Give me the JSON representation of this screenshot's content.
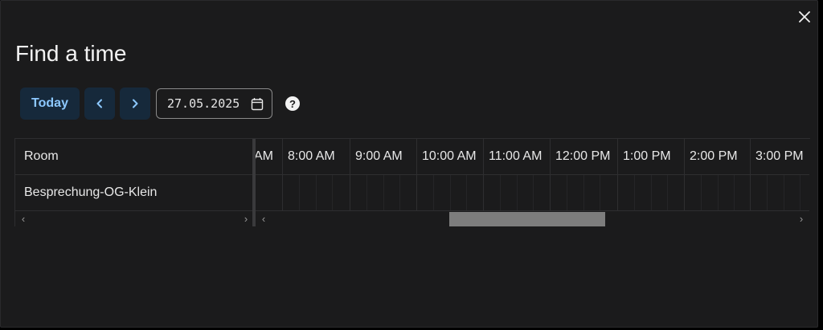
{
  "dialog": {
    "title": "Find a time",
    "close_icon": "close-icon"
  },
  "toolbar": {
    "today_label": "Today",
    "prev_icon": "chevron-left-icon",
    "next_icon": "chevron-right-icon",
    "date_value": "27.05.2025",
    "calendar_icon": "calendar-icon",
    "help_icon": "help-icon",
    "help_glyph": "?"
  },
  "grid": {
    "header_label": "Room",
    "rooms": [
      "Besprechung-OG-Klein"
    ],
    "partial_hour_label": "AM",
    "hours": [
      "8:00 AM",
      "9:00 AM",
      "10:00 AM",
      "11:00 AM",
      "12:00 PM",
      "1:00 PM",
      "2:00 PM",
      "3:00 PM"
    ]
  },
  "colors": {
    "background": "#1b1b1c",
    "accent": "#8cc8ff",
    "button_bg": "#16293b",
    "scroll_thumb": "#7d7d7d"
  }
}
